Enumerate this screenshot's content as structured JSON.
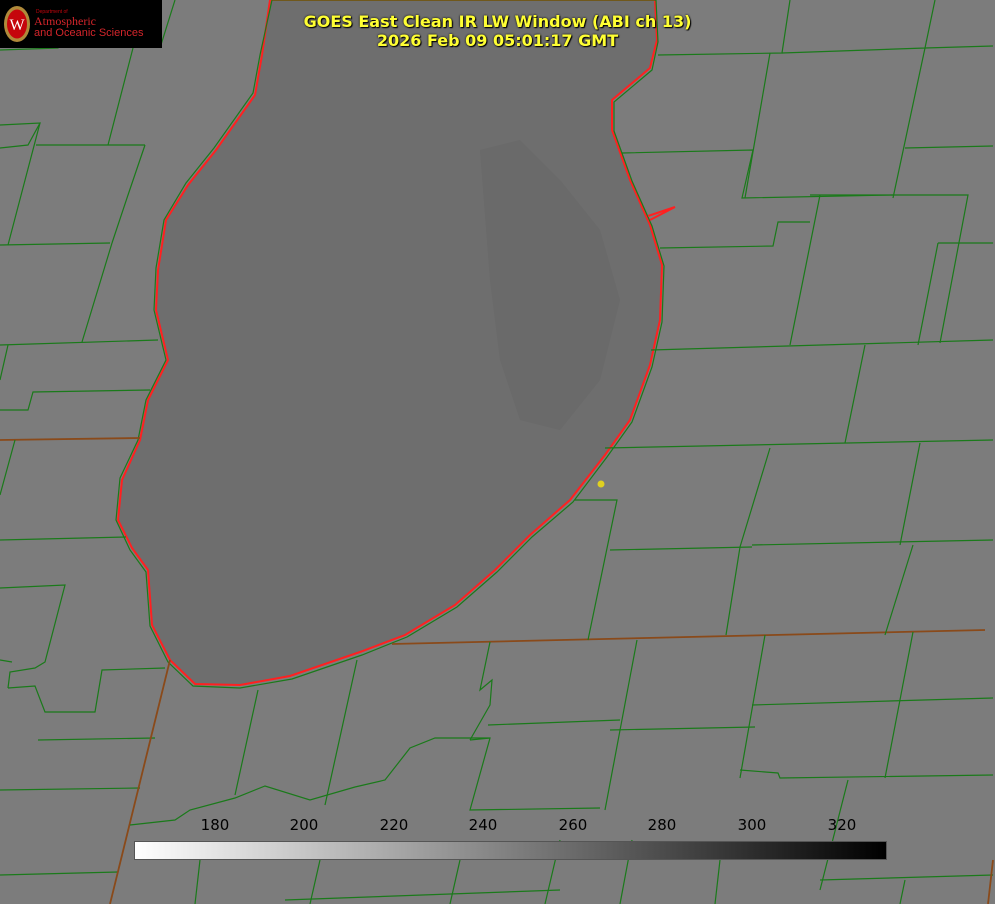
{
  "title_line1": "GOES East Clean IR LW Window (ABI ch 13)",
  "title_line2": "2026 Feb 09 05:01:17 GMT",
  "logo": {
    "dept": "Department of",
    "line1": "Atmospheric",
    "line2": "and Oceanic Sciences",
    "seal_letter": "W"
  },
  "colorbar": {
    "ticks": [
      "180",
      "200",
      "220",
      "240",
      "260",
      "280",
      "300",
      "320"
    ],
    "gradient_from": "#ffffff",
    "gradient_to": "#000000"
  },
  "colors": {
    "boundary_green": "#1a7a1a",
    "coastline_red": "#ff2020",
    "marker_yellow": "#e0d020",
    "title_yellow": "#ffff33"
  }
}
